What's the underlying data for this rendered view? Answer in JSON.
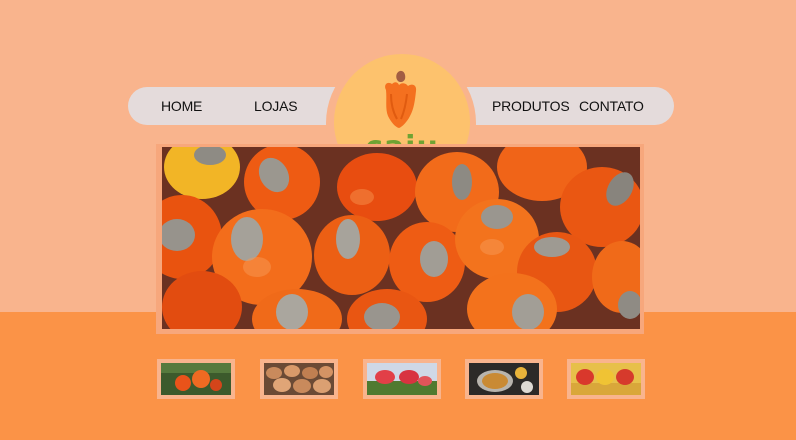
{
  "nav": {
    "left": [
      {
        "label": "HOME"
      },
      {
        "label": "LOJAS"
      }
    ],
    "right": [
      {
        "label": "PRODUTOS"
      },
      {
        "label": "CONTATO"
      }
    ]
  },
  "logo": {
    "text": "caju",
    "icon": "cashew-fruit-icon"
  },
  "colors": {
    "page_top": "#f9b48d",
    "page_bottom": "#fb9347",
    "nav_bg": "#e4dbdb",
    "logo_bg": "#fdc26d",
    "logo_text": "#6fa333",
    "fruit": "#f4701f"
  },
  "hero": {
    "image": "cashew-apples-photo"
  },
  "gallery": [
    {
      "image": "cashew-tree-photo"
    },
    {
      "image": "cashew-pile-photo"
    },
    {
      "image": "cashew-branch-photo"
    },
    {
      "image": "cashew-dish-photo"
    },
    {
      "image": "cashew-market-photo"
    }
  ]
}
